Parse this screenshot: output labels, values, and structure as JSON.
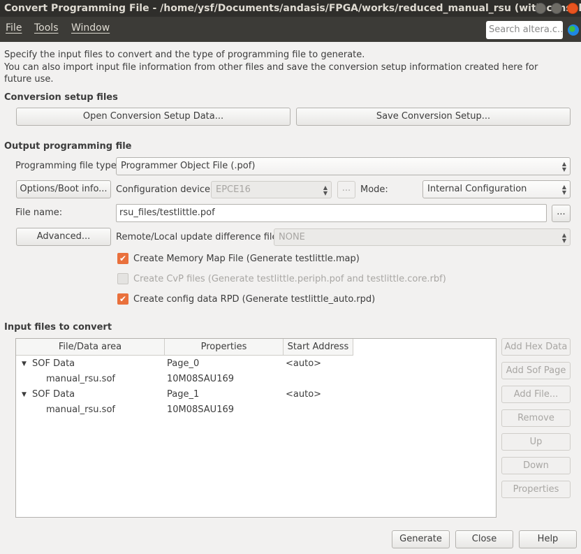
{
  "window": {
    "title": "Convert Programming File - /home/ysf/Documents/andasis/FPGA/works/reduced_manual_rsu (with consol..."
  },
  "menu": {
    "file": "File",
    "tools": "Tools",
    "window": "Window",
    "search_placeholder": "Search altera.c..."
  },
  "intro": {
    "line1": "Specify the input files to convert and the type of programming file to generate.",
    "line2": "You can also import input file information from other files and save the conversion setup information created here for",
    "line3": "future use."
  },
  "setup": {
    "heading": "Conversion setup files",
    "open": "Open Conversion Setup Data...",
    "save": "Save Conversion Setup..."
  },
  "output": {
    "heading": "Output programming file",
    "type_label": "Programming file type:",
    "type_value": "Programmer Object File (.pof)",
    "options_button": "Options/Boot info...",
    "config_label": "Configuration device:",
    "config_value": "EPCE16",
    "browse": "...",
    "mode_label": "Mode:",
    "mode_value": "Internal Configuration",
    "filename_label": "File name:",
    "filename_value": "rsu_files/testlittle.pof",
    "advanced_button": "Advanced...",
    "remote_label": "Remote/Local update difference file:",
    "remote_value": "NONE",
    "checkboxes": [
      {
        "label": "Create Memory Map File (Generate testlittle.map)",
        "checked": true,
        "enabled": true
      },
      {
        "label": "Create CvP files (Generate testlittle.periph.pof and testlittle.core.rbf)",
        "checked": false,
        "enabled": false
      },
      {
        "label": "Create config data RPD (Generate testlittle_auto.rpd)",
        "checked": true,
        "enabled": true
      }
    ]
  },
  "input": {
    "heading": "Input files to convert",
    "columns": [
      "File/Data area",
      "Properties",
      "Start Address"
    ],
    "rows": [
      {
        "name": "SOF Data",
        "prop": "Page_0",
        "addr": "<auto>"
      },
      {
        "name": "manual_rsu.sof",
        "prop": "10M08SAU169",
        "addr": ""
      },
      {
        "name": "SOF Data",
        "prop": "Page_1",
        "addr": "<auto>"
      },
      {
        "name": "manual_rsu.sof",
        "prop": "10M08SAU169",
        "addr": ""
      }
    ],
    "buttons": [
      "Add Hex Data",
      "Add Sof Page",
      "Add File...",
      "Remove",
      "Up",
      "Down",
      "Properties"
    ]
  },
  "footer": {
    "generate": "Generate",
    "close": "Close",
    "help": "Help"
  }
}
